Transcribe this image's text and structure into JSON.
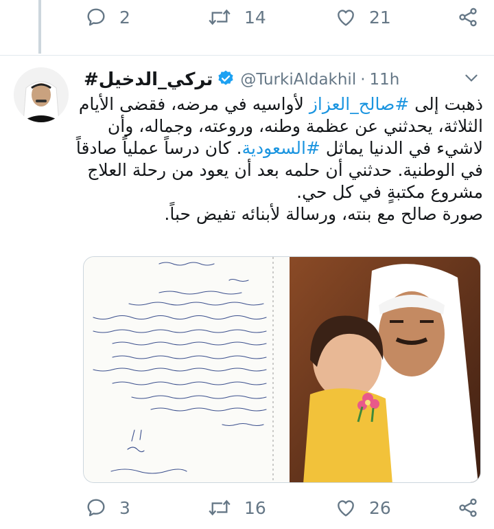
{
  "top_actions": {
    "reply_count": "2",
    "retweet_count": "14",
    "like_count": "21"
  },
  "tweet": {
    "display_name": "#تركي_الدخيل",
    "handle": "@TurkiAldakhil",
    "separator": "·",
    "time": "11h",
    "text": {
      "p1_a": "ذهبت إلى ",
      "p1_tag": "#صالح_العزاز",
      "p1_b": " لأواسيه في مرضه، فقضى الأيام الثلاثة، يحدثني عن عظمة وطنه، وروعته، وجماله، وأن لاشيء في الدنيا يماثل ",
      "p1_tag2": "#السعودية",
      "p1_c": ". كان درساً عملياً صادقاً في الوطنية. حدثني أن حلمه بعد أن يعود من رحلة العلاج مشروع مكتبةٍ في كل حي.",
      "p2": "صورة صالح مع بنته، ورسالة لأبنائه تفيض حباً."
    },
    "actions": {
      "reply_count": "3",
      "retweet_count": "16",
      "like_count": "26"
    }
  },
  "colors": {
    "link": "#1b95e0",
    "icon_gray": "#657786",
    "verified": "#1da1f2"
  }
}
